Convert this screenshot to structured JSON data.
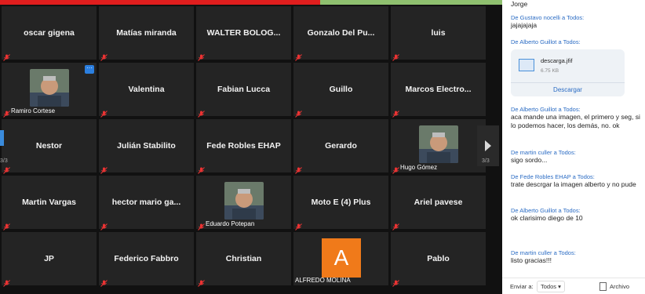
{
  "participants": [
    {
      "name": "oscar gigena"
    },
    {
      "name": "Matías miranda"
    },
    {
      "name": "WALTER BOLOG..."
    },
    {
      "name": "Gonzalo Del Pu..."
    },
    {
      "name": "luis"
    },
    {
      "name": "Ramiro Cortese",
      "photo": true
    },
    {
      "name": "Valentina"
    },
    {
      "name": "Fabian Lucca"
    },
    {
      "name": "Guillo"
    },
    {
      "name": "Marcos Electro..."
    },
    {
      "name": "Nestor"
    },
    {
      "name": "Julián Stabilito"
    },
    {
      "name": "Fede Robles EHAP"
    },
    {
      "name": "Gerardo"
    },
    {
      "name": "Hugo Gómez",
      "photo": true
    },
    {
      "name": "Martin Vargas"
    },
    {
      "name": "hector mario ga..."
    },
    {
      "name": "Eduardo Potepan",
      "photo": true
    },
    {
      "name": "Moto E (4) Plus"
    },
    {
      "name": "Ariel pavese"
    },
    {
      "name": "JP"
    },
    {
      "name": "Federico Fabbro"
    },
    {
      "name": "Christian"
    },
    {
      "name": "ALFREDO MOLINA",
      "avatar_letter": "A"
    },
    {
      "name": "Pablo"
    }
  ],
  "pager": {
    "left_page": "3/3",
    "right_page": "3/3"
  },
  "chat": {
    "top_text": "Jorge",
    "messages": [
      {
        "from": "De Gustavo nocelli a Todos:",
        "text": "jajajajaja"
      },
      {
        "from": "De Alberto Guillot a Todos:",
        "file": true
      },
      {
        "from": "De Alberto Guillot a Todos:",
        "text": "aca mande una imagen, el primero y seg, si lo podemos hacer, los demás, no. ok"
      },
      {
        "from": "De martin culler a Todos:",
        "text": "sigo sordo..."
      },
      {
        "from": "De Fede Robles EHAP a Todos:",
        "text": "trate descrgar la imagen alberto y no pude"
      },
      {
        "from": "De Alberto Guillot a Todos:",
        "text": "ok clarisimo diego de 10"
      },
      {
        "from": "De martin culler a Todos:",
        "text": "listo gracias!!!"
      }
    ],
    "file": {
      "name": "descarga.jfif",
      "size": "6.75 KB",
      "download": "Descargar"
    },
    "footer": {
      "send_to": "Enviar a:",
      "to_value": "Todos",
      "file_label": "Archivo"
    }
  },
  "colors": {
    "active_red": "#e01e1e",
    "active_green": "#8fc06f",
    "avatar_orange": "#f07a1a",
    "link_blue": "#2b6cc4"
  }
}
